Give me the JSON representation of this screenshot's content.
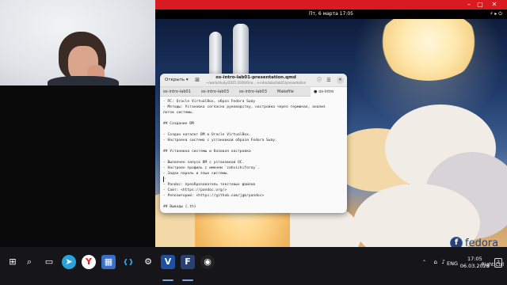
{
  "vm_window": {
    "controls": {
      "minimize": "–",
      "maximize": "▢",
      "close": "✕"
    }
  },
  "gnome": {
    "clock": "Пт, 6 марта  17:05",
    "tray": "⚡ ▸ ⏻"
  },
  "editor": {
    "open_label": "Открыть ▾",
    "title": "os-intro-lab01-presentation.qmd",
    "subtitle": "~/work/study/2025-2026/Опе... е-intro/labs/lab01/presentation",
    "tabs": [
      {
        "label": "os-intro-lab01",
        "active": false,
        "modified": false
      },
      {
        "label": "os-intro-lab03",
        "active": false,
        "modified": false
      },
      {
        "label": "os-intro-lab03",
        "active": false,
        "modified": false
      },
      {
        "label": "Makefile",
        "active": false,
        "modified": false
      },
      {
        "label": "os-intro",
        "active": true,
        "modified": true
      }
    ],
    "lines": [
      {
        "text": "- ПС: Oracle VirtualBox, образ Fedora Sway"
      },
      {
        "text": "- Методы: Установка согласно руководству, настройка через терминал, анализ"
      },
      {
        "text": "логов системы."
      },
      {
        "text": ""
      },
      {
        "text": "## Создание ВМ"
      },
      {
        "text": ""
      },
      {
        "text": "- Создан каталог ВМ в Oracle VirtualBox."
      },
      {
        "text": "- Настроена система с установкой образа Fedora Sway."
      },
      {
        "text": ""
      },
      {
        "text": "## Установка системы и базовая настройка"
      },
      {
        "text": ""
      },
      {
        "text": "- Выполнен запуск ВМ с установкой ОС."
      },
      {
        "text": "- Настроен профиль с именем `zahvickiforoy`."
      },
      {
        "text": "- Задан пароль и язык системы."
      },
      {
        "text": "-"
      },
      {
        "text": "- Pandoc: преобразователь текстовых файлов"
      },
      {
        "text": "- Сайт: <https://pandoc.org/>"
      },
      {
        "text": "- Репозиторий: <https://github.com/jgm/pandoc>"
      },
      {
        "text": ""
      },
      {
        "text": "## Выводы {.th}"
      }
    ]
  },
  "fedora_logo": {
    "mark": "f",
    "text": "fedora"
  },
  "taskbar": {
    "icons": [
      {
        "name": "windows-start-icon",
        "glyph": "⊞"
      },
      {
        "name": "search-icon",
        "glyph": "⌕"
      },
      {
        "name": "task-view-icon",
        "glyph": "▭"
      },
      {
        "name": "telegram-icon",
        "glyph": "➤"
      },
      {
        "name": "yandex-browser-icon",
        "glyph": "Y"
      },
      {
        "name": "photos-icon",
        "glyph": "▦"
      },
      {
        "name": "vscode-icon",
        "glyph": "❰❱"
      },
      {
        "name": "settings-icon",
        "glyph": "⚙"
      },
      {
        "name": "virtualbox-icon",
        "glyph": "V"
      },
      {
        "name": "virtualbox-vm-icon",
        "glyph": "F"
      },
      {
        "name": "obs-icon",
        "glyph": "◉"
      }
    ],
    "lang": "ENG",
    "time": "17:05",
    "date": "06.03.2026",
    "right_ctrl": "Right Ctrl",
    "notification_count": "2"
  }
}
